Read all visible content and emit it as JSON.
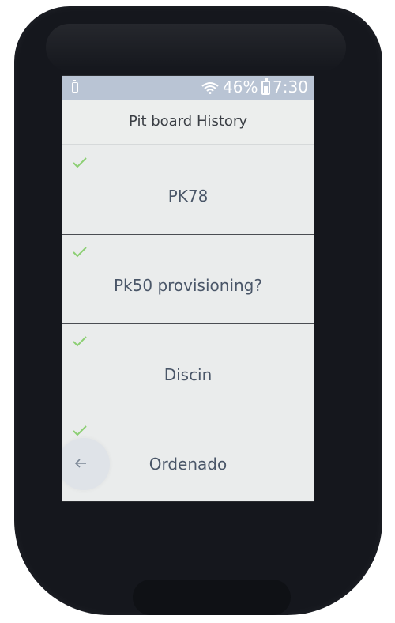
{
  "status_bar": {
    "battery_percent": "46%",
    "time": "7:30",
    "icons": [
      "phone-battery-icon",
      "wifi-icon",
      "battery-icon"
    ]
  },
  "header": {
    "title": "Pit board History"
  },
  "history": {
    "items": [
      {
        "label": "PK78",
        "icon": "check-icon"
      },
      {
        "label": "Pk50 provisioning?",
        "icon": "check-icon"
      },
      {
        "label": "Discin",
        "icon": "check-icon"
      },
      {
        "label": "Ordenado",
        "icon": "check-icon"
      }
    ]
  },
  "navigation": {
    "back_icon": "back-arrow-icon"
  },
  "colors": {
    "status_bar": "#b9c4d4",
    "screen_bg": "#e9ebea",
    "check": "#8ccf73",
    "text": "#4a5668",
    "device": "#15171d"
  }
}
